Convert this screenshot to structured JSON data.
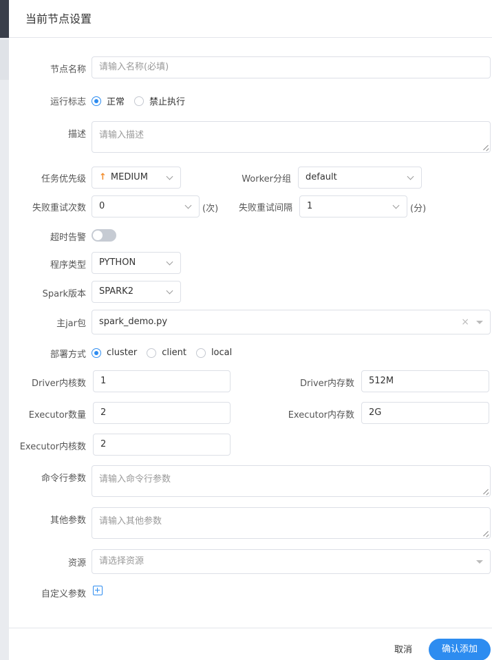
{
  "dialog": {
    "title": "当前节点设置"
  },
  "form": {
    "node_name": {
      "label": "节点名称",
      "placeholder": "请输入名称(必填)"
    },
    "run_flag": {
      "label": "运行标志",
      "options": [
        "正常",
        "禁止执行"
      ],
      "selected": "正常"
    },
    "description": {
      "label": "描述",
      "placeholder": "请输入描述"
    },
    "priority": {
      "label": "任务优先级",
      "value": "MEDIUM"
    },
    "worker_group": {
      "label": "Worker分组",
      "value": "default"
    },
    "retry_times": {
      "label": "失败重试次数",
      "value": "0",
      "unit": "(次)"
    },
    "retry_interval": {
      "label": "失败重试间隔",
      "value": "1",
      "unit": "(分)"
    },
    "timeout_alarm": {
      "label": "超时告警",
      "enabled": false
    },
    "program_type": {
      "label": "程序类型",
      "value": "PYTHON"
    },
    "spark_version": {
      "label": "Spark版本",
      "value": "SPARK2"
    },
    "main_jar": {
      "label": "主jar包",
      "value": "spark_demo.py",
      "clear": "×"
    },
    "deploy_mode": {
      "label": "部署方式",
      "options": [
        "cluster",
        "client",
        "local"
      ],
      "selected": "cluster"
    },
    "driver_cores": {
      "label": "Driver内核数",
      "value": "1"
    },
    "driver_memory": {
      "label": "Driver内存数",
      "value": "512M"
    },
    "executor_count": {
      "label": "Executor数量",
      "value": "2"
    },
    "executor_memory": {
      "label": "Executor内存数",
      "value": "2G"
    },
    "executor_cores": {
      "label": "Executor内核数",
      "value": "2"
    },
    "cmd_args": {
      "label": "命令行参数",
      "placeholder": "请输入命令行参数"
    },
    "other_args": {
      "label": "其他参数",
      "placeholder": "请输入其他参数"
    },
    "resources": {
      "label": "资源",
      "placeholder": "请选择资源"
    },
    "custom_params": {
      "label": "自定义参数"
    }
  },
  "footer": {
    "cancel_label": "取消",
    "confirm_label": "确认添加"
  },
  "colors": {
    "accent": "#2d8cf0",
    "priority_medium": "#f28d2c"
  },
  "icons": {
    "priority": "arrow-up-icon",
    "add": "plus-square-icon"
  }
}
